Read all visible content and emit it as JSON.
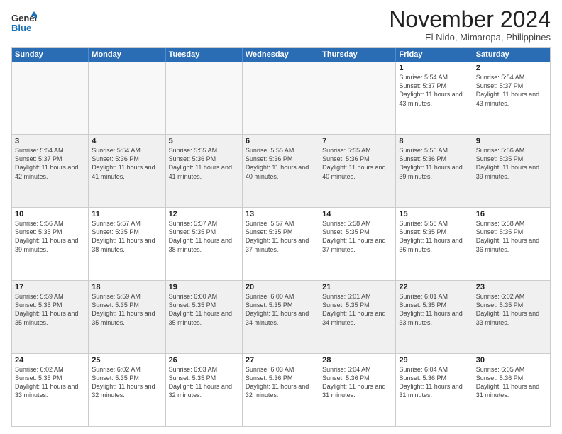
{
  "header": {
    "logo_general": "General",
    "logo_blue": "Blue",
    "month_title": "November 2024",
    "location": "El Nido, Mimaropa, Philippines"
  },
  "calendar": {
    "days_of_week": [
      "Sunday",
      "Monday",
      "Tuesday",
      "Wednesday",
      "Thursday",
      "Friday",
      "Saturday"
    ],
    "weeks": [
      [
        {
          "day": "",
          "info": "",
          "empty": true
        },
        {
          "day": "",
          "info": "",
          "empty": true
        },
        {
          "day": "",
          "info": "",
          "empty": true
        },
        {
          "day": "",
          "info": "",
          "empty": true
        },
        {
          "day": "",
          "info": "",
          "empty": true
        },
        {
          "day": "1",
          "info": "Sunrise: 5:54 AM\nSunset: 5:37 PM\nDaylight: 11 hours and 43 minutes."
        },
        {
          "day": "2",
          "info": "Sunrise: 5:54 AM\nSunset: 5:37 PM\nDaylight: 11 hours and 43 minutes."
        }
      ],
      [
        {
          "day": "3",
          "info": "Sunrise: 5:54 AM\nSunset: 5:37 PM\nDaylight: 11 hours and 42 minutes."
        },
        {
          "day": "4",
          "info": "Sunrise: 5:54 AM\nSunset: 5:36 PM\nDaylight: 11 hours and 41 minutes."
        },
        {
          "day": "5",
          "info": "Sunrise: 5:55 AM\nSunset: 5:36 PM\nDaylight: 11 hours and 41 minutes."
        },
        {
          "day": "6",
          "info": "Sunrise: 5:55 AM\nSunset: 5:36 PM\nDaylight: 11 hours and 40 minutes."
        },
        {
          "day": "7",
          "info": "Sunrise: 5:55 AM\nSunset: 5:36 PM\nDaylight: 11 hours and 40 minutes."
        },
        {
          "day": "8",
          "info": "Sunrise: 5:56 AM\nSunset: 5:36 PM\nDaylight: 11 hours and 39 minutes."
        },
        {
          "day": "9",
          "info": "Sunrise: 5:56 AM\nSunset: 5:35 PM\nDaylight: 11 hours and 39 minutes."
        }
      ],
      [
        {
          "day": "10",
          "info": "Sunrise: 5:56 AM\nSunset: 5:35 PM\nDaylight: 11 hours and 39 minutes."
        },
        {
          "day": "11",
          "info": "Sunrise: 5:57 AM\nSunset: 5:35 PM\nDaylight: 11 hours and 38 minutes."
        },
        {
          "day": "12",
          "info": "Sunrise: 5:57 AM\nSunset: 5:35 PM\nDaylight: 11 hours and 38 minutes."
        },
        {
          "day": "13",
          "info": "Sunrise: 5:57 AM\nSunset: 5:35 PM\nDaylight: 11 hours and 37 minutes."
        },
        {
          "day": "14",
          "info": "Sunrise: 5:58 AM\nSunset: 5:35 PM\nDaylight: 11 hours and 37 minutes."
        },
        {
          "day": "15",
          "info": "Sunrise: 5:58 AM\nSunset: 5:35 PM\nDaylight: 11 hours and 36 minutes."
        },
        {
          "day": "16",
          "info": "Sunrise: 5:58 AM\nSunset: 5:35 PM\nDaylight: 11 hours and 36 minutes."
        }
      ],
      [
        {
          "day": "17",
          "info": "Sunrise: 5:59 AM\nSunset: 5:35 PM\nDaylight: 11 hours and 35 minutes."
        },
        {
          "day": "18",
          "info": "Sunrise: 5:59 AM\nSunset: 5:35 PM\nDaylight: 11 hours and 35 minutes."
        },
        {
          "day": "19",
          "info": "Sunrise: 6:00 AM\nSunset: 5:35 PM\nDaylight: 11 hours and 35 minutes."
        },
        {
          "day": "20",
          "info": "Sunrise: 6:00 AM\nSunset: 5:35 PM\nDaylight: 11 hours and 34 minutes."
        },
        {
          "day": "21",
          "info": "Sunrise: 6:01 AM\nSunset: 5:35 PM\nDaylight: 11 hours and 34 minutes."
        },
        {
          "day": "22",
          "info": "Sunrise: 6:01 AM\nSunset: 5:35 PM\nDaylight: 11 hours and 33 minutes."
        },
        {
          "day": "23",
          "info": "Sunrise: 6:02 AM\nSunset: 5:35 PM\nDaylight: 11 hours and 33 minutes."
        }
      ],
      [
        {
          "day": "24",
          "info": "Sunrise: 6:02 AM\nSunset: 5:35 PM\nDaylight: 11 hours and 33 minutes."
        },
        {
          "day": "25",
          "info": "Sunrise: 6:02 AM\nSunset: 5:35 PM\nDaylight: 11 hours and 32 minutes."
        },
        {
          "day": "26",
          "info": "Sunrise: 6:03 AM\nSunset: 5:35 PM\nDaylight: 11 hours and 32 minutes."
        },
        {
          "day": "27",
          "info": "Sunrise: 6:03 AM\nSunset: 5:36 PM\nDaylight: 11 hours and 32 minutes."
        },
        {
          "day": "28",
          "info": "Sunrise: 6:04 AM\nSunset: 5:36 PM\nDaylight: 11 hours and 31 minutes."
        },
        {
          "day": "29",
          "info": "Sunrise: 6:04 AM\nSunset: 5:36 PM\nDaylight: 11 hours and 31 minutes."
        },
        {
          "day": "30",
          "info": "Sunrise: 6:05 AM\nSunset: 5:36 PM\nDaylight: 11 hours and 31 minutes."
        }
      ]
    ]
  }
}
